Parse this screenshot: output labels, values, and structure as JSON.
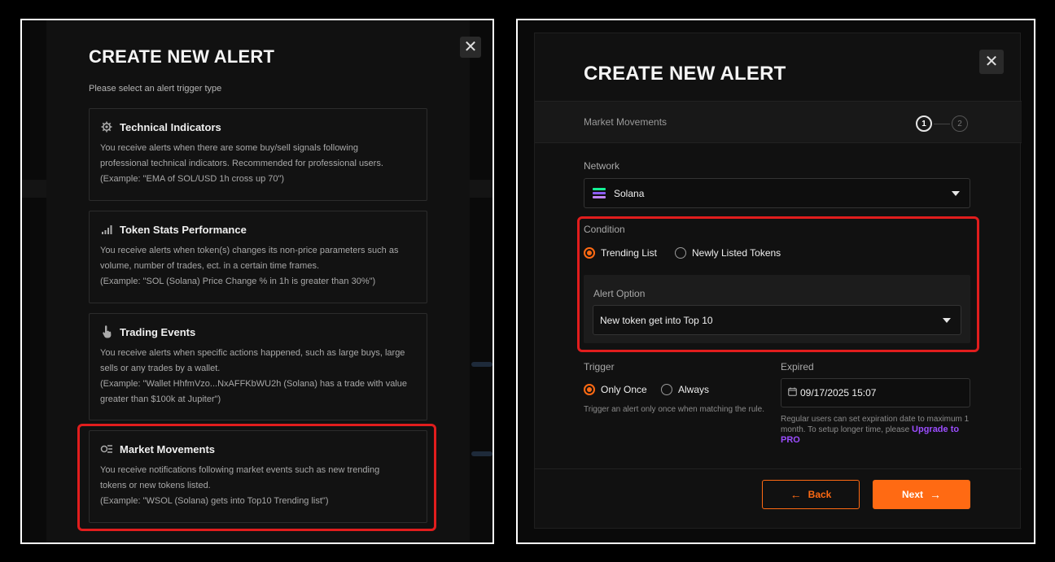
{
  "left_modal": {
    "title": "CREATE NEW ALERT",
    "subtitle": "Please select an alert trigger type",
    "close_glyph": "✕",
    "trigger_types": [
      {
        "icon": "gear-icon",
        "title": "Technical Indicators",
        "lines": [
          "You receive alerts when there are some buy/sell signals following",
          "professional technical indicators. Recommended for professional users.",
          "(Example: \"EMA of SOL/USD 1h cross up 70\")"
        ]
      },
      {
        "icon": "bar-chart-icon",
        "title": "Token Stats Performance",
        "lines": [
          "You receive alerts when token(s) changes its non-price parameters such as",
          "volume, number of trades, ect. in a certain time frames.",
          "(Example: \"SOL (Solana) Price Change % in 1h is greater than 30%\")"
        ]
      },
      {
        "icon": "hand-pointer-icon",
        "title": "Trading Events",
        "lines": [
          "You receive alerts when specific actions happened, such as large buys, large",
          "sells or any trades by a wallet.",
          "(Example: \"Wallet HhfmVzo...NxAFFKbWU2h (Solana) has a trade with value",
          "greater than $100k at Jupiter\")"
        ]
      },
      {
        "icon": "market-movements-icon",
        "title": "Market Movements",
        "lines": [
          "You receive notifications following market events such as new trending",
          "tokens or new tokens listed.",
          "(Example: \"WSOL (Solana) gets into Top10 Trending list\")"
        ]
      }
    ]
  },
  "right_modal": {
    "title": "CREATE NEW ALERT",
    "close_glyph": "✕",
    "step_label": "Market Movements",
    "steps": [
      "1",
      "2"
    ],
    "network": {
      "label": "Network",
      "value": "Solana"
    },
    "condition": {
      "label": "Condition",
      "options": [
        "Trending List",
        "Newly Listed Tokens"
      ],
      "selected": "Trending List"
    },
    "alert_option": {
      "label": "Alert Option",
      "value": "New token get into Top 10"
    },
    "trigger": {
      "label": "Trigger",
      "options": [
        "Only Once",
        "Always"
      ],
      "selected": "Only Once",
      "help": "Trigger an alert only once when matching the rule."
    },
    "expired": {
      "label": "Expired",
      "value": "09/17/2025 15:07",
      "help": "Regular users can set expiration date to maximum 1 month. To setup longer time, please",
      "upgrade_link": "Upgrade to PRO"
    },
    "buttons": {
      "back": "Back",
      "next": "Next"
    }
  },
  "colors": {
    "accent": "#ff6a13",
    "highlight": "#e11d1d",
    "link": "#9b4dff"
  }
}
